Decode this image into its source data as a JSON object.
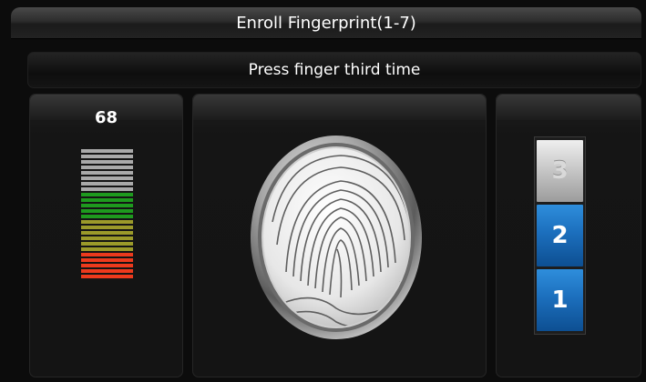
{
  "window": {
    "title": "Enroll Fingerprint(1-7)"
  },
  "status": {
    "message": "Press finger third time"
  },
  "quality": {
    "score": "68",
    "bar_colors": [
      "#a9a9a9",
      "#a9a9a9",
      "#a9a9a9",
      "#a9a9a9",
      "#a9a9a9",
      "#a9a9a9",
      "#a9a9a9",
      "#a9a9a9",
      "#1e9a1e",
      "#1e9a1e",
      "#1e9a1e",
      "#1e9a1e",
      "#1e9a1e",
      "#9b9a2a",
      "#9b9a2a",
      "#9b9a2a",
      "#9b9a2a",
      "#9b9a2a",
      "#9b9a2a",
      "#ec3a1d",
      "#ec3a1d",
      "#ec3a1d",
      "#ec3a1d",
      "#ec3a1d"
    ]
  },
  "fingerprint": {
    "icon": "fingerprint-scan-image"
  },
  "steps": {
    "items": [
      {
        "label": "3",
        "state": "pending"
      },
      {
        "label": "2",
        "state": "done"
      },
      {
        "label": "1",
        "state": "done"
      }
    ],
    "colors": {
      "done": "#1c6fbd",
      "pending": "#c9c9c9"
    }
  }
}
